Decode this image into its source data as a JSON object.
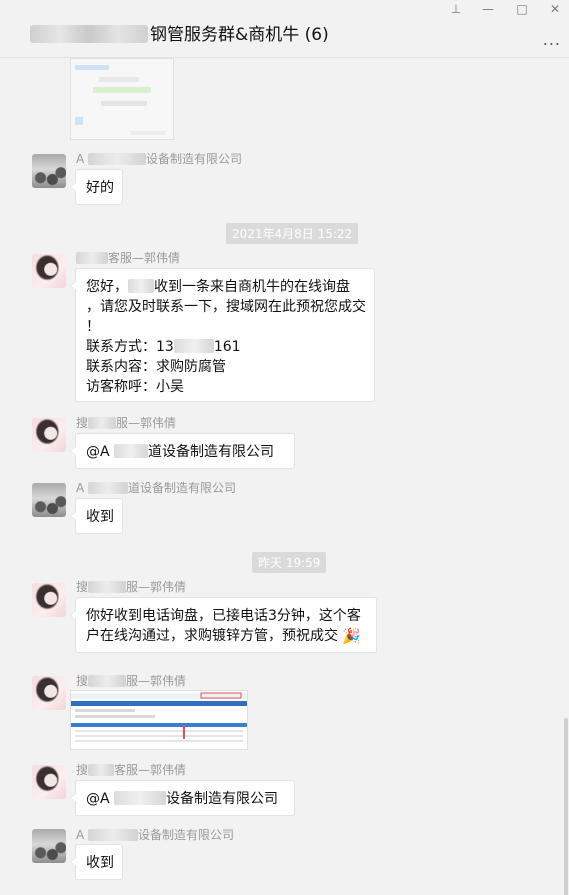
{
  "window": {
    "title": "钢管服务群&商机牛 (6)",
    "controls": {
      "pin": "⊥",
      "minimize": "—",
      "maximize": "□",
      "close": "✕"
    },
    "more": "..."
  },
  "messages": {
    "m1": {
      "sender_prefix": "A",
      "sender_suffix": "设备制造有限公司",
      "text": "好的"
    },
    "ts1": "2021年4月8日 15:22",
    "m2": {
      "sender_suffix": "客服—郭伟倩",
      "line1_a": "您好，",
      "line1_b": "收到一条来自商机牛的在线询盘",
      "line2": "，请您及时联系一下，搜域网在此预祝您成交",
      "line3": "！",
      "line4_a": "联系方式：13",
      "line4_b": "161",
      "line5": "联系内容：求购防腐管",
      "line6": "访客称呼：小吴"
    },
    "m3": {
      "sender_prefix": "搜",
      "sender_suffix": "服—郭伟倩",
      "text_a": "@A",
      "text_b": "道设备制造有限公司"
    },
    "m4": {
      "sender_prefix": "A",
      "sender_suffix": "道设备制造有限公司",
      "text": "收到"
    },
    "ts2": "昨天 19:59",
    "m5": {
      "sender_prefix": "搜",
      "sender_suffix": "服—郭伟倩",
      "line1": "你好收到电话询盘，已接电话3分钟，这个客",
      "line2": "户在线沟通过，求购镀锌方管，预祝成交"
    },
    "m6": {
      "sender_prefix": "搜",
      "sender_suffix": "服—郭伟倩"
    },
    "m7": {
      "sender_prefix": "搜",
      "sender_suffix": "客服—郭伟倩",
      "text_a": "@A",
      "text_b": "设备制造有限公司"
    },
    "m8": {
      "sender_prefix": "A",
      "sender_suffix": "设备制造有限公司",
      "text": "收到"
    }
  }
}
